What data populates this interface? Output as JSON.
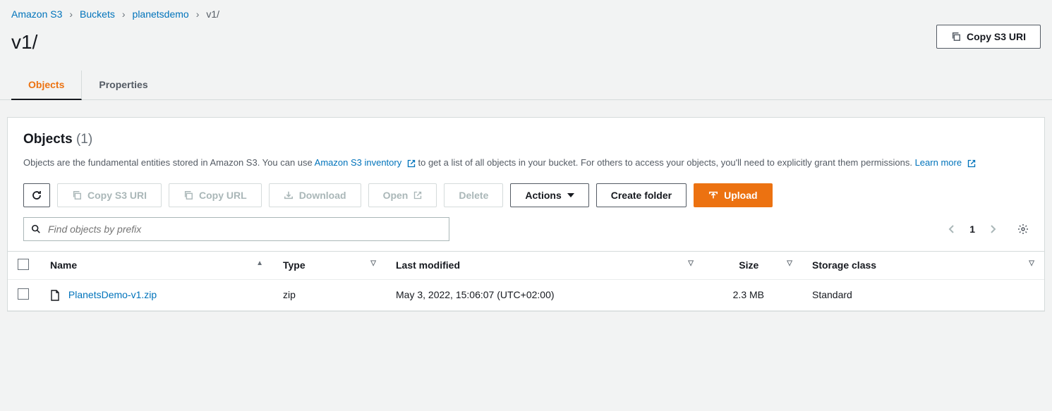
{
  "breadcrumb": {
    "items": [
      "Amazon S3",
      "Buckets",
      "planetsdemo"
    ],
    "current": "v1/"
  },
  "header": {
    "title": "v1/",
    "copy_uri": "Copy S3 URI"
  },
  "tabs": {
    "objects": "Objects",
    "properties": "Properties"
  },
  "panel": {
    "title": "Objects",
    "count": "(1)",
    "desc_pre": "Objects are the fundamental entities stored in Amazon S3. You can use ",
    "desc_link1": "Amazon S3 inventory",
    "desc_mid": " to get a list of all objects in your bucket. For others to access your objects, you'll need to explicitly grant them permissions. ",
    "desc_link2": "Learn more"
  },
  "toolbar": {
    "copy_uri": "Copy S3 URI",
    "copy_url": "Copy URL",
    "download": "Download",
    "open": "Open",
    "delete": "Delete",
    "actions": "Actions",
    "create_folder": "Create folder",
    "upload": "Upload"
  },
  "search": {
    "placeholder": "Find objects by prefix"
  },
  "pagination": {
    "page": "1"
  },
  "table": {
    "headers": {
      "name": "Name",
      "type": "Type",
      "last_modified": "Last modified",
      "size": "Size",
      "storage_class": "Storage class"
    },
    "rows": [
      {
        "name": "PlanetsDemo-v1.zip",
        "type": "zip",
        "last_modified": "May 3, 2022, 15:06:07 (UTC+02:00)",
        "size": "2.3 MB",
        "storage_class": "Standard"
      }
    ]
  }
}
